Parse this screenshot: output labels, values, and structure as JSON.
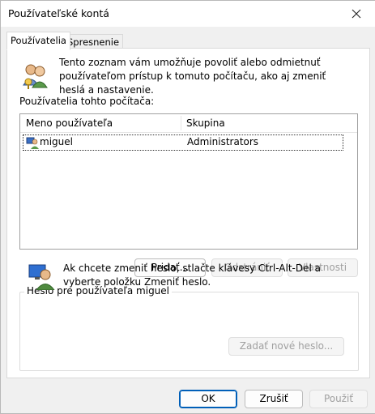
{
  "window": {
    "title": "Používateľské kontá"
  },
  "tabs": [
    {
      "label": "Používatelia"
    },
    {
      "label": "Spresnenie"
    }
  ],
  "intro_text": "Tento zoznam vám umožňuje povoliť alebo odmietnuť používateľom prístup k tomuto počítaču, ako aj zmeniť heslá a nastavenie.",
  "users_label": "Používatelia tohto počítača:",
  "table": {
    "columns": [
      "Meno používateľa",
      "Skupina"
    ],
    "rows": [
      {
        "name": "miguel",
        "group": "Administrators"
      }
    ]
  },
  "buttons": {
    "add": "Pridať...",
    "remove": "Odstrániť",
    "properties": "Vlastnosti"
  },
  "password_group": {
    "title": "Heslo pre používateľa miguel",
    "text": "Ak chcete zmeniť heslo, stlačte klávesy Ctrl-Alt-Del a vyberte položku Zmeniť heslo.",
    "reset_button": "Zadať nové heslo..."
  },
  "dialog_buttons": {
    "ok": "OK",
    "cancel": "Zrušiť",
    "apply": "Použiť"
  },
  "icons": {
    "close": "close-icon",
    "users": "users-icon",
    "user_row": "user-icon",
    "password": "password-icon"
  },
  "colors": {
    "accent": "#005fb8"
  }
}
